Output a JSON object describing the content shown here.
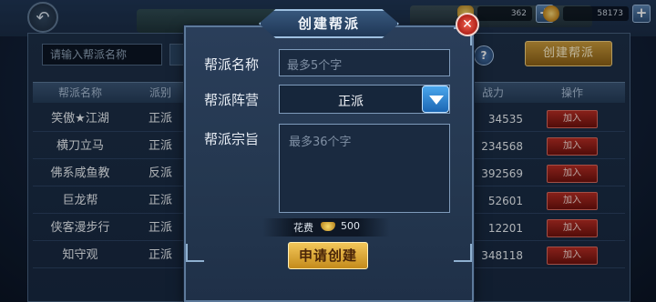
{
  "top": {
    "back_icon": "back-arrow-icon",
    "currency1_value": "362",
    "currency2_value": "58173",
    "plus_label": "+"
  },
  "panel": {
    "search_placeholder": "请输入帮派名称",
    "help_label": "?",
    "create_button": "创建帮派",
    "columns": [
      "帮派名称",
      "派别",
      "战力",
      "操作"
    ],
    "rows": [
      {
        "name": "笑傲★江湖",
        "faction": "正派",
        "power": "34535",
        "action": "加入"
      },
      {
        "name": "横刀立马",
        "faction": "正派",
        "power": "234568",
        "action": "加入"
      },
      {
        "name": "佛系咸鱼教",
        "faction": "反派",
        "power": "392569",
        "action": "加入"
      },
      {
        "name": "巨龙帮",
        "faction": "正派",
        "power": "52601",
        "action": "加入"
      },
      {
        "name": "侠客漫步行",
        "faction": "正派",
        "power": "12201",
        "action": "加入"
      },
      {
        "name": "知守观",
        "faction": "正派",
        "power": "348118",
        "action": "加入"
      }
    ]
  },
  "modal": {
    "title": "创建帮派",
    "close_label": "✕",
    "name_label": "帮派名称",
    "name_placeholder": "最多5个字",
    "camp_label": "帮派阵营",
    "camp_value": "正派",
    "purpose_label": "帮派宗旨",
    "purpose_placeholder": "最多36个字",
    "cost_label": "花费",
    "cost_value": "500",
    "submit_label": "申请创建"
  }
}
